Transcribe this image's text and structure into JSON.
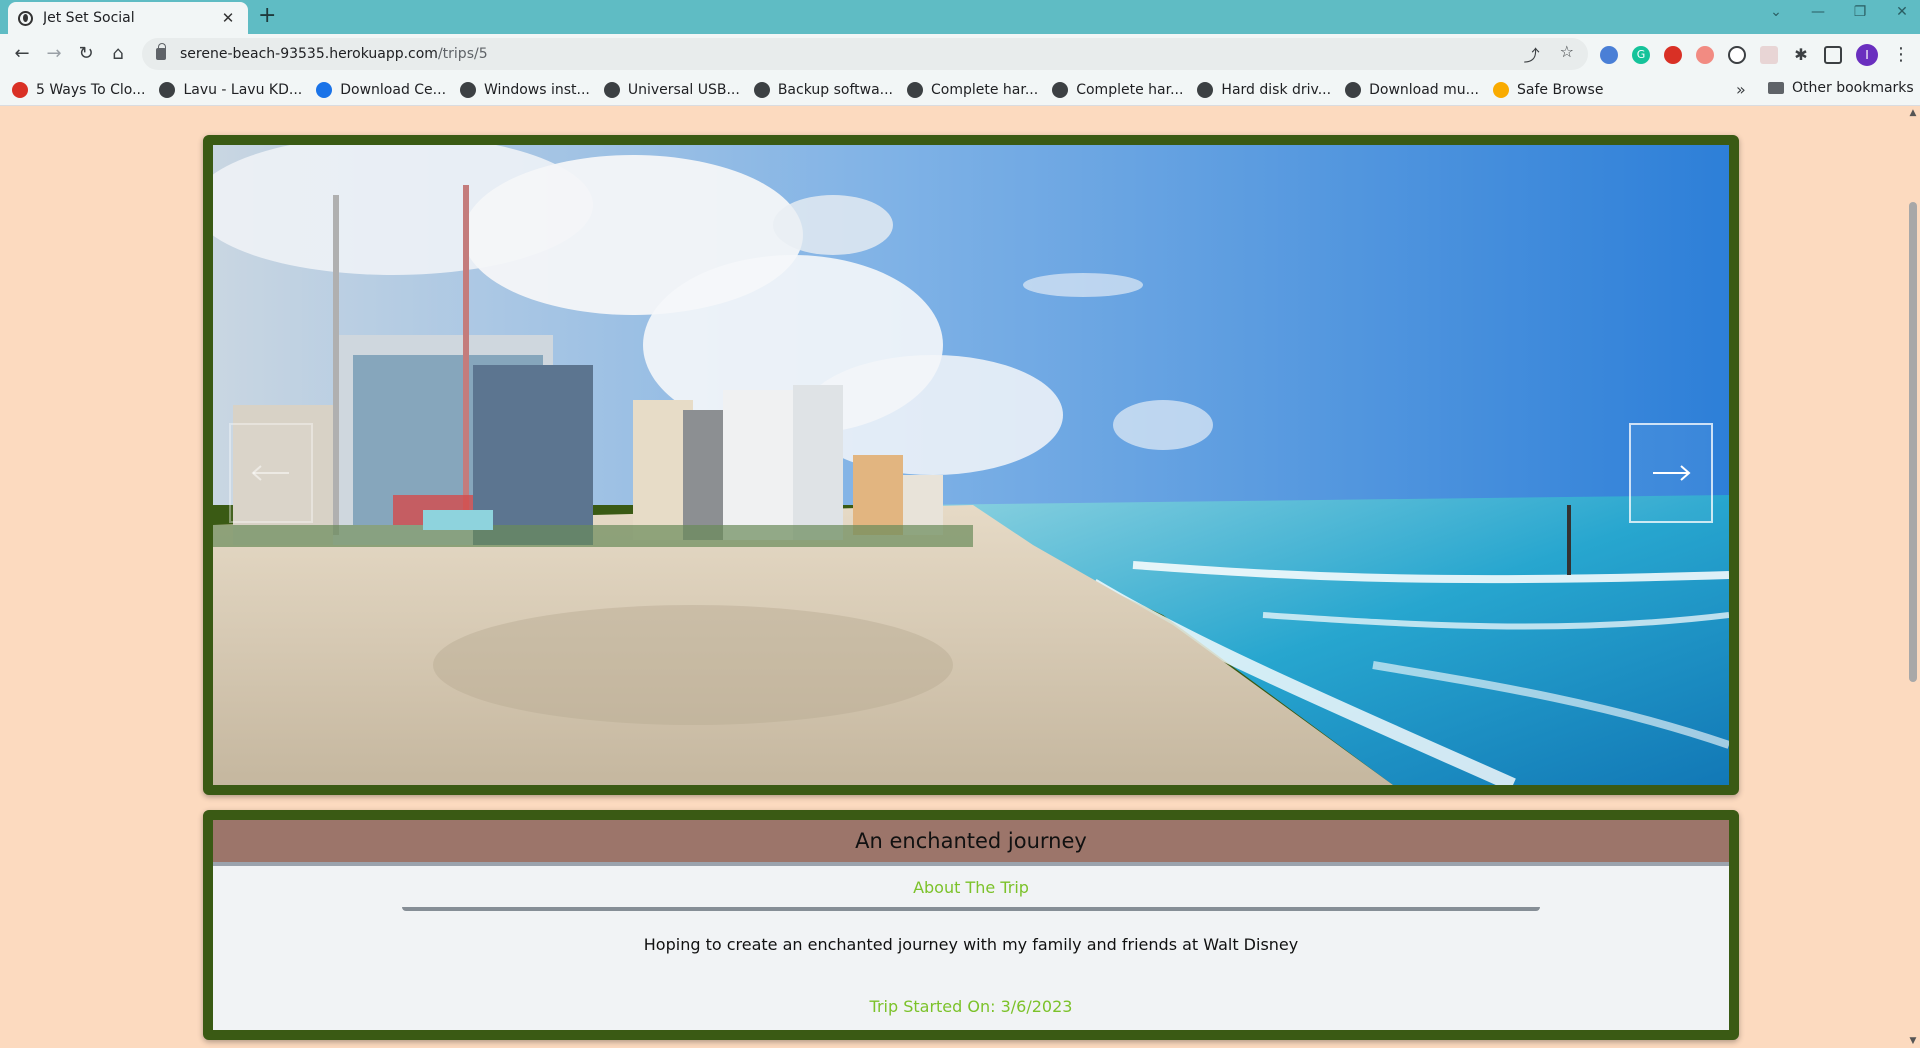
{
  "browser": {
    "tab_title": "Jet Set Social",
    "url_host": "serene-beach-93535.herokuapp.com",
    "url_path": "/trips/5",
    "bookmarks": [
      {
        "label": "5 Ways To Clo...",
        "icon_color": "#d93025"
      },
      {
        "label": "Lavu - Lavu KD...",
        "icon_color": "#3c4043"
      },
      {
        "label": "Download Ce...",
        "icon_color": "#1a73e8"
      },
      {
        "label": "Windows inst...",
        "icon_color": "#3c4043"
      },
      {
        "label": "Universal USB...",
        "icon_color": "#3c4043"
      },
      {
        "label": "Backup softwa...",
        "icon_color": "#3c4043"
      },
      {
        "label": "Complete har...",
        "icon_color": "#3c4043"
      },
      {
        "label": "Complete har...",
        "icon_color": "#3c4043"
      },
      {
        "label": "Hard disk driv...",
        "icon_color": "#3c4043"
      },
      {
        "label": "Download mu...",
        "icon_color": "#3c4043"
      },
      {
        "label": "Safe Browse",
        "icon_color": "#f9ab00"
      }
    ],
    "other_bookmarks": "Other bookmarks",
    "profile_initial": "I"
  },
  "carousel": {
    "prev_icon": "arrow-left-icon",
    "next_icon": "arrow-right-icon"
  },
  "trip": {
    "title": "An enchanted journey",
    "about_heading": "About The Trip",
    "description": "Hoping to create an enchanted journey with my family and friends at Walt Disney",
    "started_label": "Trip Started On: 3/6/2023"
  },
  "colors": {
    "page_bg": "#fcdabf",
    "frame_green": "#3a5a14",
    "header_brown": "#9c756a",
    "accent_green": "#7cc22a"
  }
}
